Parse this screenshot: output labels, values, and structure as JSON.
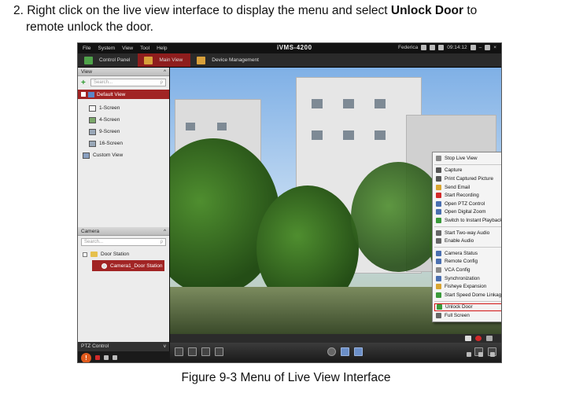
{
  "doc": {
    "step_prefix": "2. Right click on the live view interface to display the menu and select ",
    "step_bold": "Unlock Door",
    "step_suffix": " to",
    "step_line2": "remote unlock the door.",
    "caption": "Figure 9-3 Menu of Live View Interface"
  },
  "app": {
    "title": "iVMS-4200",
    "menu": [
      "File",
      "System",
      "View",
      "Tool",
      "Help"
    ],
    "user": "Federica",
    "clock": "09:14:12",
    "tabs": [
      {
        "label": "Control Panel",
        "icon": "control-panel-icon",
        "color": "#4fa34a"
      },
      {
        "label": "Main View",
        "icon": "main-view-icon",
        "color": "#d8a03a"
      },
      {
        "label": "Device Management",
        "icon": "device-management-icon",
        "color": "#d8a03a"
      }
    ],
    "active_tab": "Main View"
  },
  "left": {
    "view_header": "View",
    "view_search": "Search...",
    "default_view": "Default View",
    "screens": [
      "1-Screen",
      "4-Screen",
      "9-Screen",
      "16-Screen"
    ],
    "custom_view": "Custom View",
    "camera_header": "Camera",
    "camera_search": "Search...",
    "door_station": "Door Station",
    "camera_item": "Camera1_Door Station",
    "ptz_header": "PTZ Control"
  },
  "context_menu": {
    "groups": [
      [
        {
          "label": "Stop Live View",
          "icon": "stop-icon",
          "color": "#888888"
        }
      ],
      [
        {
          "label": "Capture",
          "icon": "camera-icon",
          "color": "#555555"
        },
        {
          "label": "Print Captured Picture",
          "icon": "print-icon",
          "color": "#555555"
        },
        {
          "label": "Send Email",
          "icon": "email-icon",
          "color": "#d9a531"
        },
        {
          "label": "Start Recording",
          "icon": "record-icon",
          "color": "#d22a2a"
        },
        {
          "label": "Open PTZ Control",
          "icon": "ptz-icon",
          "color": "#4a6fb0"
        },
        {
          "label": "Open Digital Zoom",
          "icon": "zoom-icon",
          "color": "#4a6fb0"
        },
        {
          "label": "Switch to Instant Playback",
          "icon": "playback-icon",
          "color": "#3a9a3a",
          "submenu": "▸"
        }
      ],
      [
        {
          "label": "Start Two-way Audio",
          "icon": "microphone-icon",
          "color": "#666666"
        },
        {
          "label": "Enable Audio",
          "icon": "speaker-icon",
          "color": "#666666"
        }
      ],
      [
        {
          "label": "Camera Status",
          "icon": "status-icon",
          "color": "#4a6fb0"
        },
        {
          "label": "Remote Config",
          "icon": "config-icon",
          "color": "#4a6fb0"
        },
        {
          "label": "VCA Config",
          "icon": "vca-icon",
          "color": "#8a8a8a"
        },
        {
          "label": "Synchronization",
          "icon": "sync-icon",
          "color": "#4a6fb0"
        },
        {
          "label": "Fisheye Expansion",
          "icon": "fisheye-icon",
          "color": "#d9a531"
        },
        {
          "label": "Start Speed Dome Linkage",
          "icon": "linkage-icon",
          "color": "#3a9a3a"
        }
      ],
      [
        {
          "label": "Unlock Door",
          "icon": "unlock-icon",
          "color": "#3a9a3a",
          "highlight": true
        },
        {
          "label": "Full Screen",
          "icon": "fullscreen-icon",
          "color": "#666666"
        }
      ]
    ]
  },
  "colors": {
    "accent_red": "#a12424",
    "highlight_border": "#d21414"
  }
}
